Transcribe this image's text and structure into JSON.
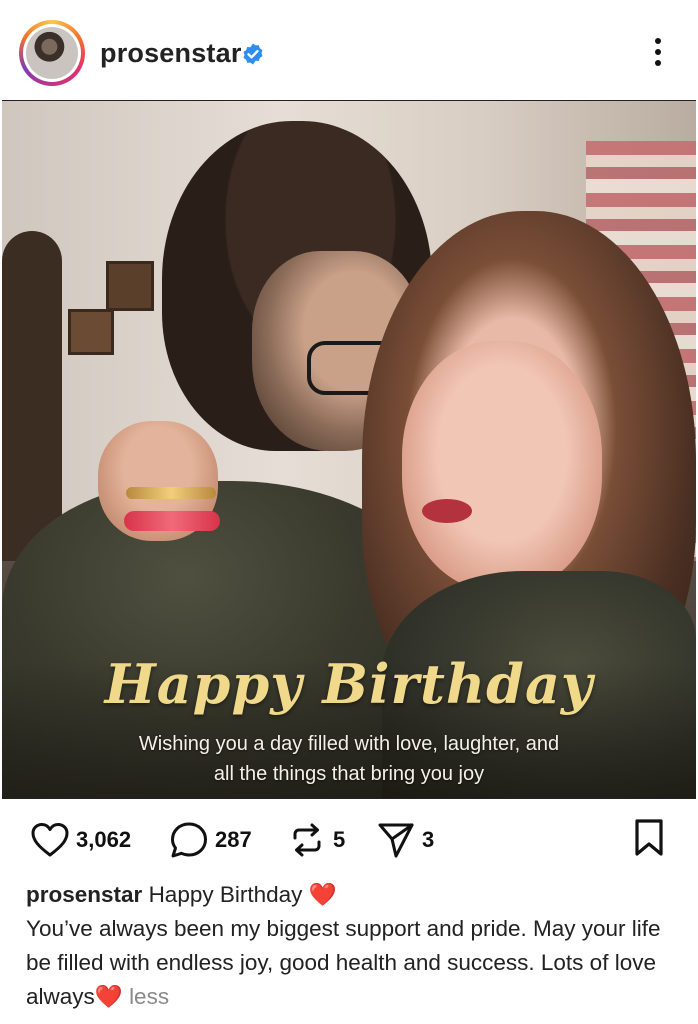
{
  "header": {
    "username": "prosenstar",
    "verified": true,
    "more_icon": "more-vertical-icon"
  },
  "post_image": {
    "title": "Happy Birthday",
    "subtitle_line1": "Wishing you a day filled with love, laughter, and",
    "subtitle_line2": "all the things that bring you joy"
  },
  "actions": {
    "likes": "3,062",
    "comments": "287",
    "reposts": "5",
    "shares": "3",
    "icons": [
      "heart-icon",
      "comment-icon",
      "repost-icon",
      "share-icon",
      "bookmark-icon"
    ]
  },
  "caption": {
    "username": "prosenstar",
    "first_line": "Happy Birthday",
    "emoji_heart": "❤️",
    "body": "You’ve always been my biggest support and pride. May your life be filled with endless joy, good health and success. Lots of love always",
    "less_label": "less"
  },
  "colors": {
    "verified_blue": "#2f8cf0",
    "title_gold": "#f0d98a",
    "heart_red": "#e0242f"
  }
}
